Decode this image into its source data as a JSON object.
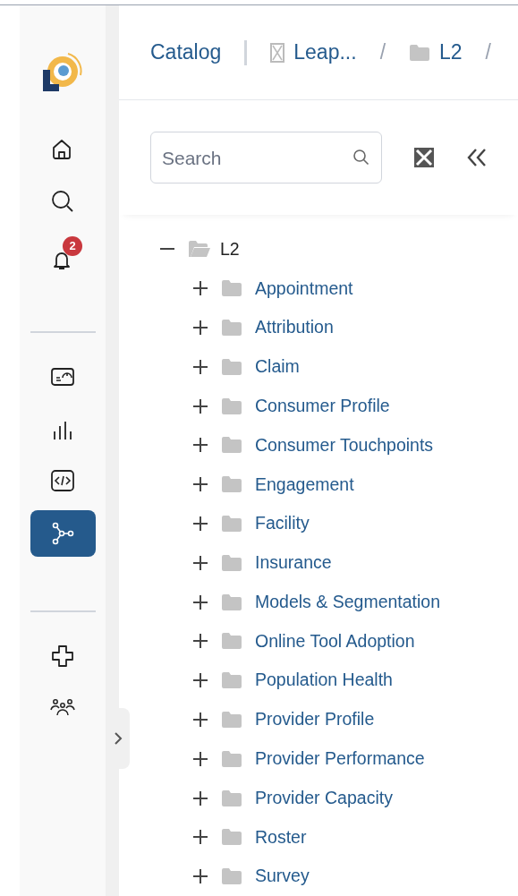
{
  "sidebar": {
    "items": [
      {
        "kind": "home",
        "selected": false
      },
      {
        "kind": "search",
        "selected": false
      },
      {
        "kind": "bell",
        "selected": false,
        "badge": "2"
      },
      {
        "kind": "divider"
      },
      {
        "kind": "gauge",
        "selected": false
      },
      {
        "kind": "bars",
        "selected": false
      },
      {
        "kind": "code",
        "selected": false
      },
      {
        "kind": "network",
        "selected": true
      },
      {
        "kind": "divider"
      },
      {
        "kind": "cross",
        "selected": false
      },
      {
        "kind": "people",
        "selected": false
      }
    ]
  },
  "breadcrumb": [
    {
      "kind": "link",
      "label": "Catalog"
    },
    {
      "kind": "bar"
    },
    {
      "kind": "database",
      "label": "Leap..."
    },
    {
      "kind": "slash",
      "label": "/"
    },
    {
      "kind": "folder",
      "label": "L2"
    },
    {
      "kind": "slash",
      "label": "/"
    }
  ],
  "search": {
    "placeholder": "Search"
  },
  "tree": [
    {
      "label": "L2",
      "expanded": true,
      "children": [
        {
          "label": "Appointment",
          "expanded": false
        },
        {
          "label": "Attribution",
          "expanded": false
        },
        {
          "label": "Claim",
          "expanded": false
        },
        {
          "label": "Consumer Profile",
          "expanded": false
        },
        {
          "label": "Consumer Touchpoints",
          "expanded": false
        },
        {
          "label": "Engagement",
          "expanded": false
        },
        {
          "label": "Facility",
          "expanded": false
        },
        {
          "label": "Insurance",
          "expanded": false
        },
        {
          "label": "Models & Segmentation",
          "expanded": false
        },
        {
          "label": "Online Tool Adoption",
          "expanded": false
        },
        {
          "label": "Population Health",
          "expanded": false
        },
        {
          "label": "Provider Profile",
          "expanded": false
        },
        {
          "label": "Provider Performance",
          "expanded": false
        },
        {
          "label": "Provider Capacity",
          "expanded": false
        },
        {
          "label": "Roster",
          "expanded": false
        },
        {
          "label": "Survey",
          "expanded": false
        }
      ]
    }
  ]
}
